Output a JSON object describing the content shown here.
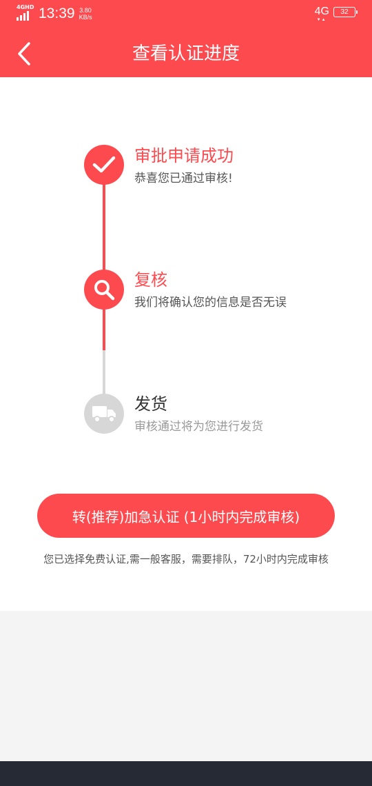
{
  "status_bar": {
    "network_label": "4GHD",
    "time": "13:39",
    "speed_value": "3.80",
    "speed_unit": "KB/s",
    "signal_label": "4G",
    "battery": "32"
  },
  "header": {
    "title": "查看认证进度",
    "back_icon": "chevron-left-icon"
  },
  "steps": [
    {
      "title": "审批申请成功",
      "desc": "恭喜您已通过审核!",
      "icon": "check-icon",
      "status": "done"
    },
    {
      "title": "复核",
      "desc": "我们将确认您的信息是否无误",
      "icon": "search-icon",
      "status": "active"
    },
    {
      "title": "发货",
      "desc": "审核通过将为您进行发货",
      "icon": "truck-icon",
      "status": "pending"
    }
  ],
  "urgent_button": {
    "label": "转(推荐)加急认证 (1小时内完成审核)"
  },
  "notice": "您已选择免费认证,需一般客服，需要排队，72小时内完成审核",
  "colors": {
    "accent": "#fd4a4f",
    "inactive": "#d7d7d7",
    "title_dark": "#333333",
    "desc_text": "#666666",
    "desc_pending": "#999999",
    "page_bg": "#f4f4f4",
    "nav_bottom": "#252a35"
  }
}
